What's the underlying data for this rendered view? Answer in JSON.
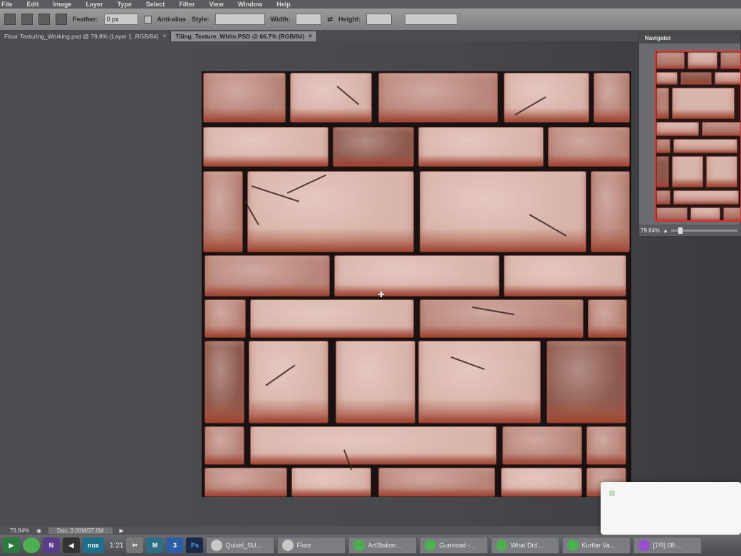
{
  "menu": [
    "File",
    "Edit",
    "Image",
    "Layer",
    "Type",
    "Select",
    "Filter",
    "View",
    "Window",
    "Help"
  ],
  "options": {
    "feather_label": "Feather:",
    "feather_value": "0 px",
    "antialias_label": "Anti-alias",
    "style_label": "Style:",
    "width_label": "Width:",
    "height_label": "Height:"
  },
  "tabs": [
    {
      "label": "Floor Texturing_Working.psd @ 79.8% (Layer 1, RGB/8#)",
      "close": "×",
      "active": false
    },
    {
      "label": "Tiling_Texture_White.PSD @ 66.7% (RGB/8#)",
      "close": "×",
      "active": true
    }
  ],
  "navigator": {
    "title": "Navigator",
    "zoom": "79.84%"
  },
  "status": {
    "zoom": "79.84%",
    "doc": "Doc: 3.00M/37.0M"
  },
  "taskbar": {
    "clock": "1:21",
    "items": [
      {
        "label": "Quixel_SU...",
        "color": "#c8c8c8"
      },
      {
        "label": "Floor",
        "color": "#c8c8c8"
      },
      {
        "label": "ArtStation...",
        "color": "#4caf50"
      },
      {
        "label": "Gumroad -...",
        "color": "#4caf50"
      },
      {
        "label": "What Did ...",
        "color": "#4caf50"
      },
      {
        "label": "Kurtlar Va...",
        "color": "#4caf50"
      },
      {
        "label": "[7/9] 08-...",
        "color": "#9b4fd0"
      }
    ]
  },
  "colors": {
    "brick_base": "#b8867a",
    "brick_light": "#d8b4aa",
    "brick_dark": "#8c5a4e",
    "mortar": "#1a1211",
    "nav_frame": "#d83030"
  }
}
